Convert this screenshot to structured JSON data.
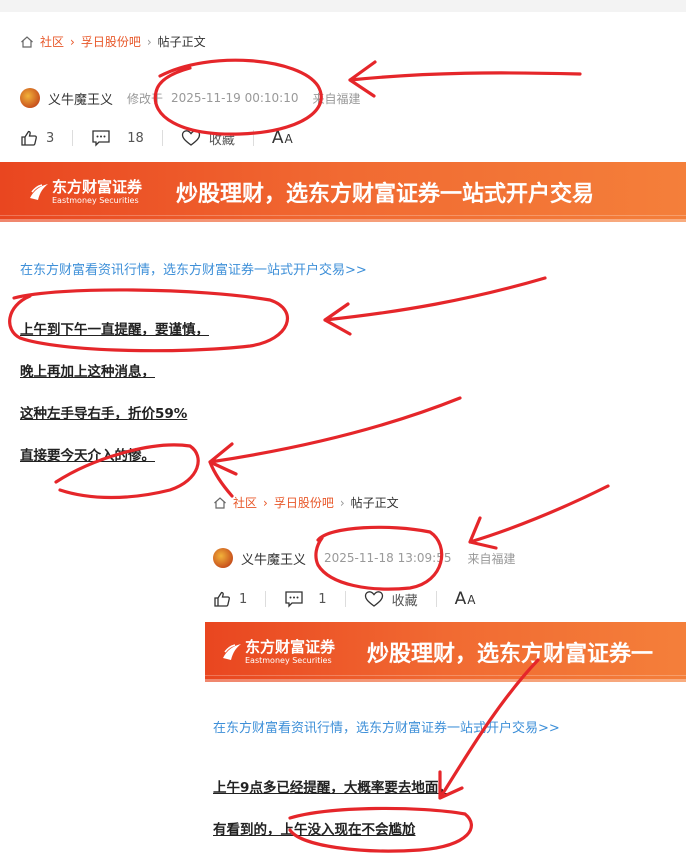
{
  "post1": {
    "breadcrumb": {
      "community": "社区",
      "bar": "孚日股份吧",
      "current": "帖子正文"
    },
    "author": "义牛魔王义",
    "modified_label": "修改于",
    "timestamp": "2025-11-19 00:10:10",
    "source": "来自福建",
    "likes": "3",
    "comments": "18",
    "favorite_label": "收藏",
    "font_size_label": "A",
    "font_size_label_small": "A",
    "banner": {
      "logo_cn": "东方财富证券",
      "logo_en": "Eastmoney Securities",
      "slogan": "炒股理财，选东方财富证券一站式开户交易"
    },
    "promo_link": "在东方财富看资讯行情，选东方财富证券一站式开户交易>>",
    "paragraphs": [
      "上午到下午一直提醒，要谨慎，",
      "晚上再加上这种消息，",
      "这种左手导右手，折价59%",
      "直接要今天介入的惨。"
    ]
  },
  "post2": {
    "breadcrumb": {
      "community": "社区",
      "bar": "孚日股份吧",
      "current": "帖子正文"
    },
    "author": "义牛魔王义",
    "timestamp": "2025-11-18 13:09:55",
    "source": "来自福建",
    "likes": "1",
    "comments": "1",
    "favorite_label": "收藏",
    "font_size_label": "A",
    "font_size_label_small": "A",
    "banner": {
      "logo_cn": "东方财富证券",
      "logo_en": "Eastmoney Securities",
      "slogan": "炒股理财，选东方财富证券一"
    },
    "promo_link": "在东方财富看资讯行情，选东方财富证券一站式开户交易>>",
    "paragraphs": [
      "上午9点多已经提醒，大概率要去地面，",
      "有看到的，上午没入现在不会尴尬"
    ]
  },
  "colors": {
    "accent": "#e8582a",
    "link_blue": "#3d8fd8",
    "annotation_red": "#e5262a"
  },
  "icons": [
    "home-icon",
    "chevron-right-icon",
    "thumbs-up-icon",
    "comment-icon",
    "heart-icon",
    "font-size-icon"
  ]
}
